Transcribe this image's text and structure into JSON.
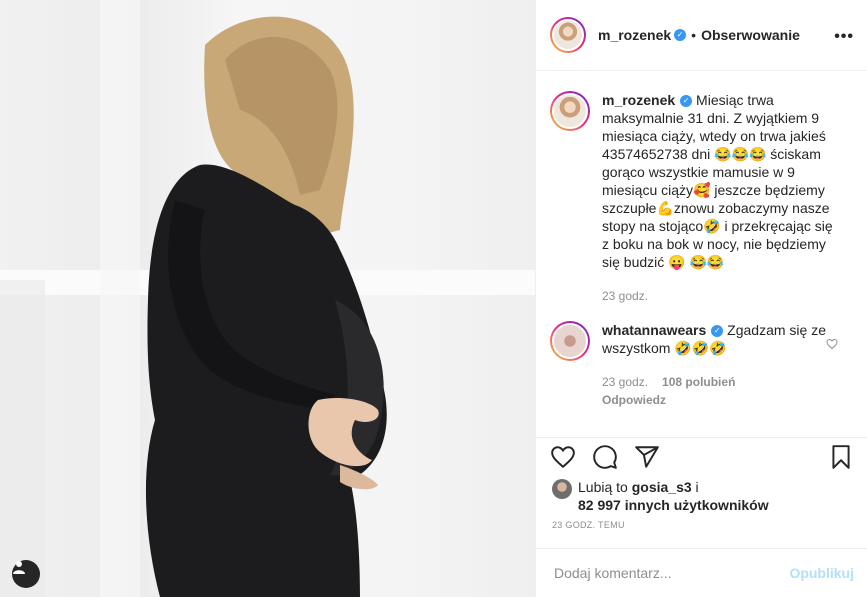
{
  "post": {
    "image_alt": "Kobieta w ciąży w czarnej sukience",
    "user_tag_icon": "user-icon"
  },
  "header": {
    "username": "m_rozenek",
    "separator": "•",
    "follow_label": "Obserwowanie",
    "more_icon": "more-icon",
    "more_label": "•••"
  },
  "caption": {
    "username": "m_rozenek",
    "text": "Miesiąc trwa maksymalnie 31 dni. Z wyjątkiem 9 miesiąca ciąży, wtedy on trwa jakieś 43574652738 dni 😂😂😂 ściskam gorąco wszystkie mamusie w 9 miesiącu ciąży🥰 jeszcze będziemy szczupłe💪znowu zobaczymy nasze stopy na stojąco🤣 i przekręcając się z boku na bok w nocy, nie będziemy się budzić 😛 😂😂",
    "time": "23 godz."
  },
  "comment": {
    "username": "whatannawears",
    "text": "Zgadzam się ze wszystkom 🤣🤣🤣",
    "time": "23 godz.",
    "likes": "108 polubień",
    "reply": "Odpowiedz"
  },
  "actions": {
    "like_icon": "heart-icon",
    "comment_icon": "comment-icon",
    "share_icon": "share-icon",
    "save_icon": "bookmark-icon"
  },
  "likes": {
    "prefix": "Lubią to ",
    "user": "gosia_s3",
    "suffix": " i",
    "others": "82 997 innych użytkowników"
  },
  "timestamp": "23 GODZ. TEMU",
  "add_comment": {
    "placeholder": "Dodaj komentarz...",
    "publish_label": "Opublikuj"
  },
  "colors": {
    "verified": "#3897f0",
    "publish_disabled": "#b2dffc"
  }
}
